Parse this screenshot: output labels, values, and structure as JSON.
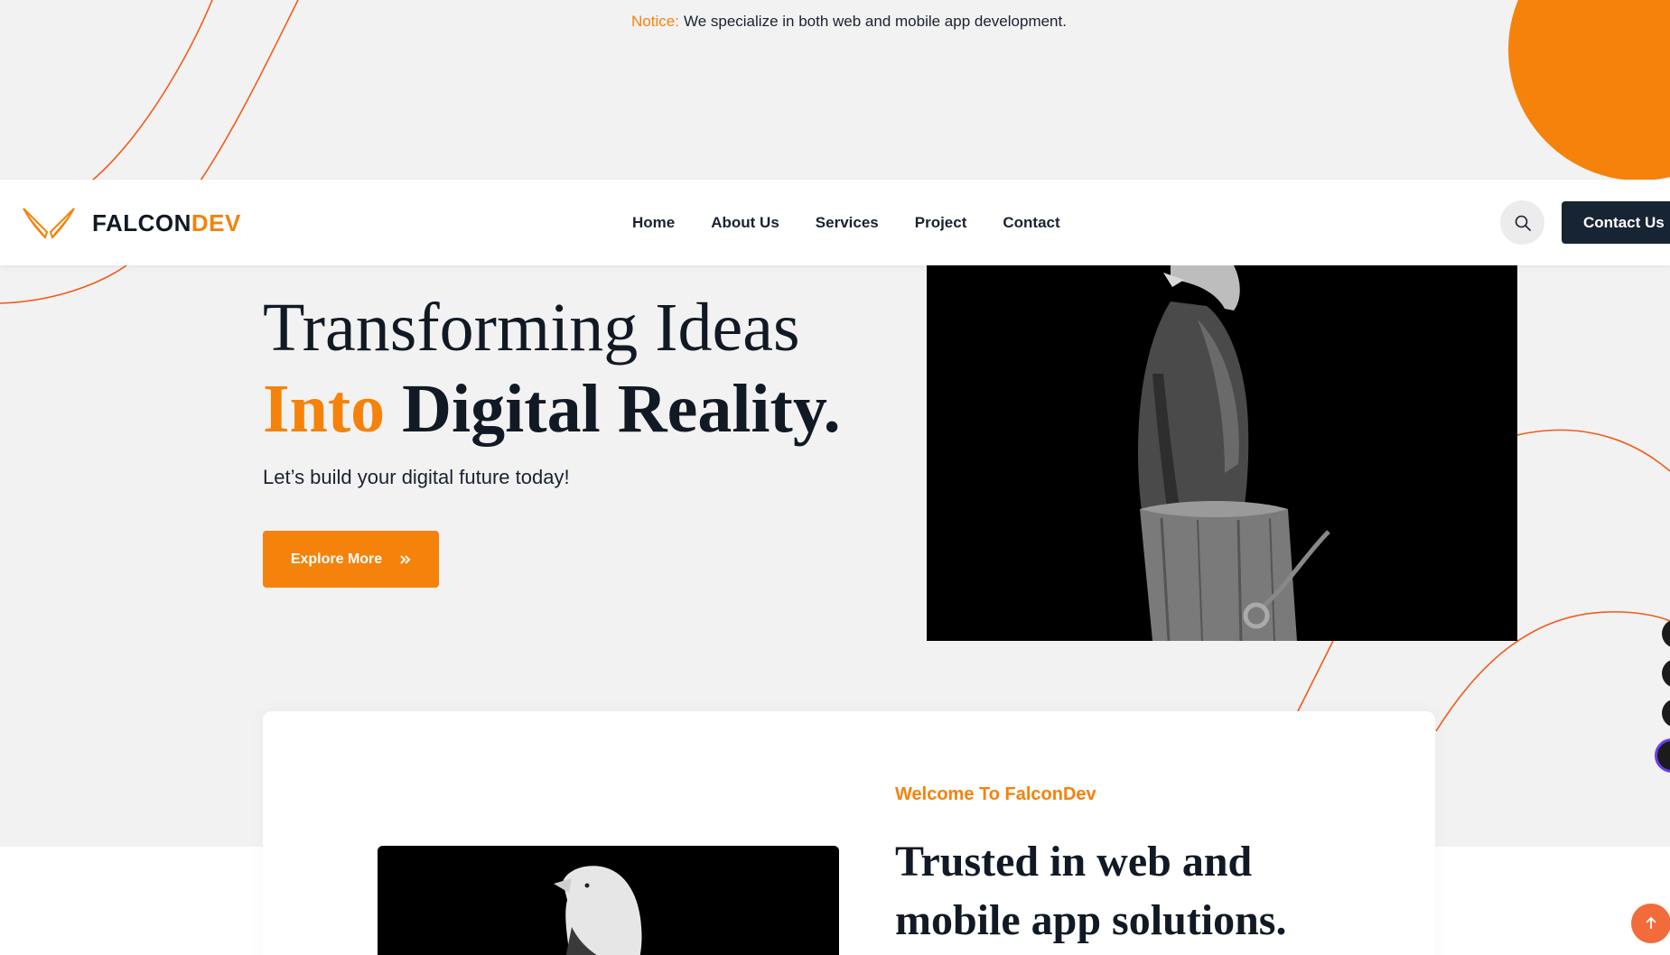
{
  "colors": {
    "accent": "#f5820b",
    "dark": "#172433",
    "page_bg": "#f2f2f2",
    "deco_line": "#f25a1a",
    "scroll_top": "#f26b3a"
  },
  "notice": {
    "label": "Notice:",
    "text": "We specialize in both web and mobile app development."
  },
  "navbar": {
    "logo": {
      "icon": "falcon-wings-icon",
      "text_main": "FALCON",
      "text_accent": "DEV"
    },
    "menu": [
      {
        "label": "Home"
      },
      {
        "label": "About Us"
      },
      {
        "label": "Services"
      },
      {
        "label": "Project"
      },
      {
        "label": "Contact"
      }
    ],
    "search_icon": "search-icon",
    "contact_button": "Contact Us"
  },
  "hero": {
    "title_line1": "Transforming Ideas",
    "title_accent": "Into",
    "title_line2_rest": "Digital Reality.",
    "subtitle": "Let’s build your digital future today!",
    "button_label": "Explore More",
    "button_icon": "double-chevron-right-icon",
    "image": "eagle-on-post-photo"
  },
  "about": {
    "eyebrow": "Welcome To FalconDev",
    "title_line1": "Trusted in web and",
    "title_line2": "mobile app solutions.",
    "image": "eagle-portrait-photo"
  },
  "floating": {
    "scroll_top_icon": "arrow-up-icon"
  }
}
